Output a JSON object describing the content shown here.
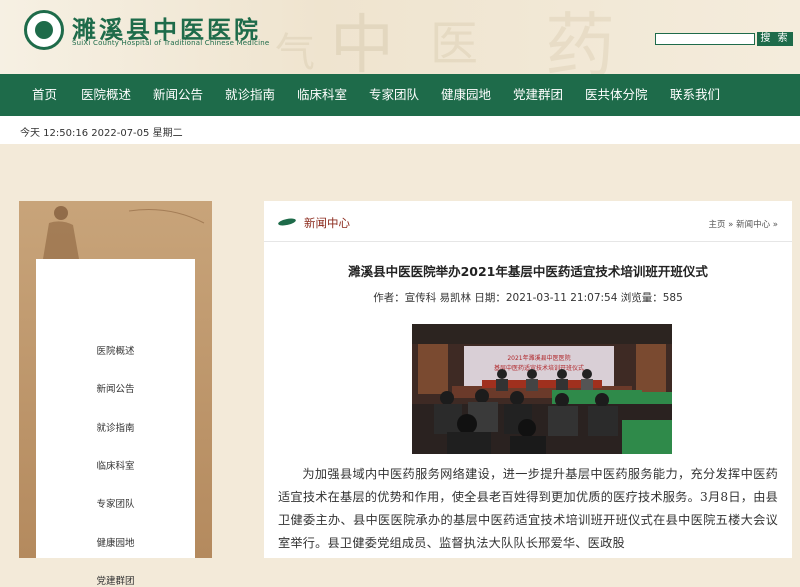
{
  "header": {
    "logo_cn": "濉溪县中医医院",
    "logo_en": "SuiXi County Hospital of Traditional Chinese Medicine",
    "search_value": "",
    "search_button": "搜 索"
  },
  "nav": [
    "首页",
    "医院概述",
    "新闻公告",
    "就诊指南",
    "临床科室",
    "专家团队",
    "健康园地",
    "党建群团",
    "医共体分院",
    "联系我们"
  ],
  "datetime": "今天 12:50:16 2022-07-05 星期二",
  "sidebar": [
    "医院概述",
    "新闻公告",
    "就诊指南",
    "临床科室",
    "专家团队",
    "健康园地",
    "党建群团"
  ],
  "section": {
    "title": "新闻中心",
    "breadcrumb": "主页 » 新闻中心 »"
  },
  "article": {
    "title": "濉溪县中医医院举办2021年基层中医药适宜技术培训班开班仪式",
    "meta": "作者：宣传科 易凯林 日期：2021-03-11 21:07:54 浏览量：585",
    "photo_banner_line1": "2021年濉溪县中医医院",
    "photo_banner_line2": "基层中医药适宜技术培训开班仪式",
    "body": "为加强县域内中医药服务网络建设，进一步提升基层中医药服务能力，充分发挥中医药适宜技术在基层的优势和作用，使全县老百姓得到更加优质的医疗技术服务。3月8日，由县卫健委主办、县中医医院承办的基层中医药适宜技术培训班开班仪式在县中医院五楼大会议室举行。县卫健委党组成员、监督执法大队队长邢爱华、医政股"
  },
  "colors": {
    "primary": "#1e6b4a",
    "accent": "#8b2a1c",
    "background": "#f3ead9",
    "sidebar": "#b48a5e"
  }
}
